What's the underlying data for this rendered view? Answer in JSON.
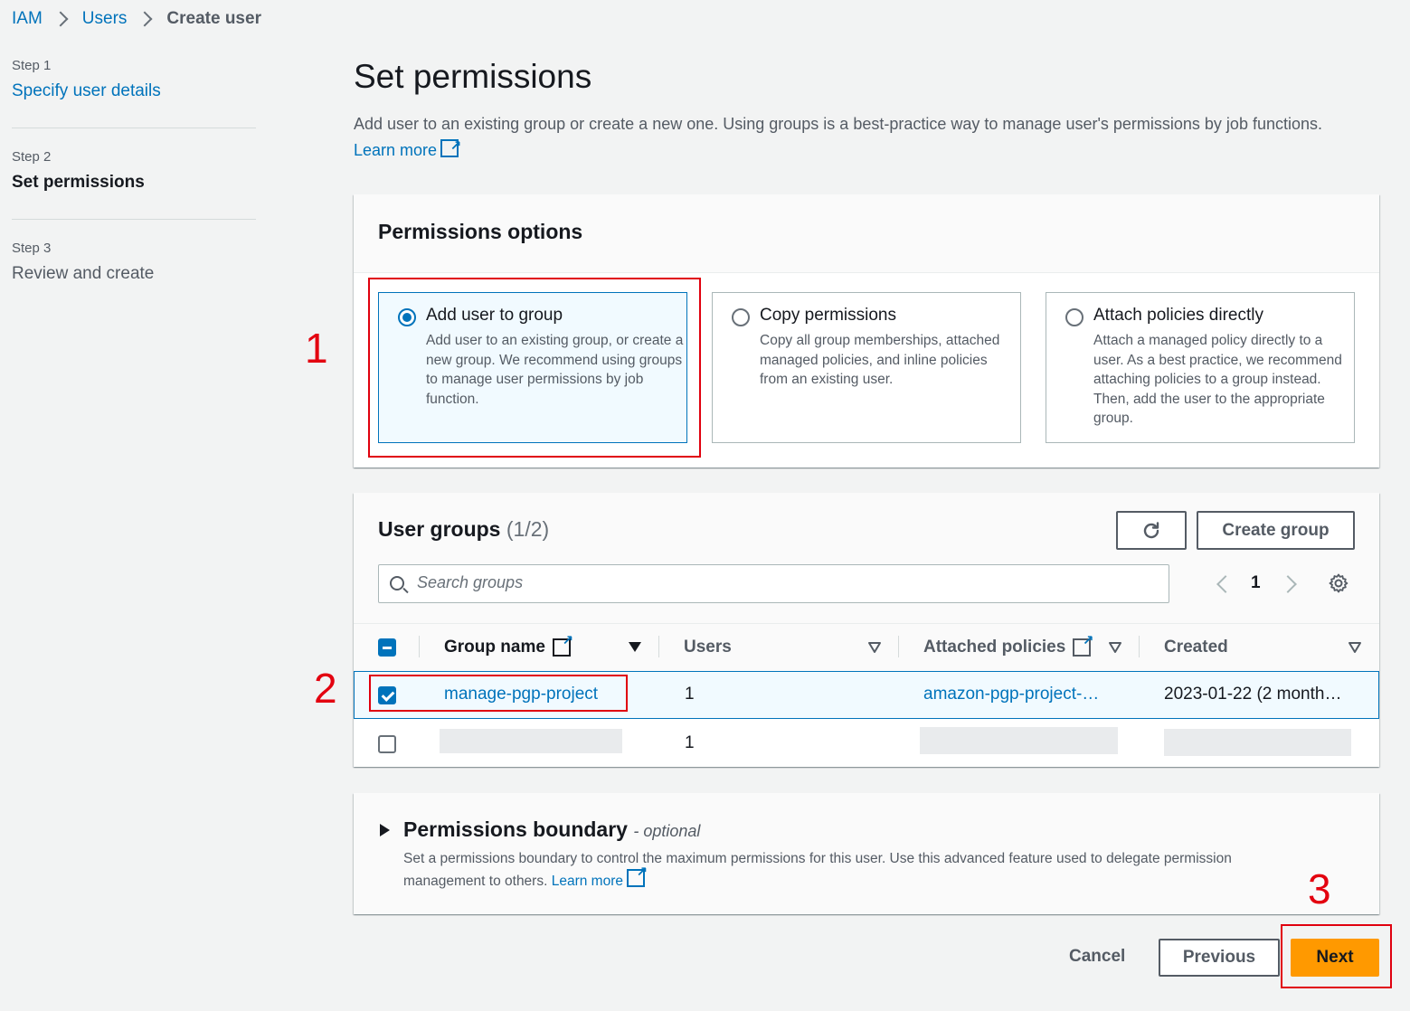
{
  "breadcrumb": {
    "iam": "IAM",
    "users": "Users",
    "current": "Create user"
  },
  "steps": [
    {
      "num": "Step 1",
      "title": "Specify user details"
    },
    {
      "num": "Step 2",
      "title": "Set permissions"
    },
    {
      "num": "Step 3",
      "title": "Review and create"
    }
  ],
  "header": {
    "title": "Set permissions",
    "description": "Add user to an existing group or create a new one. Using groups is a best-practice way to manage user's permissions by job functions.",
    "learn_more": "Learn more"
  },
  "permissions_options": {
    "heading": "Permissions options",
    "options": [
      {
        "title": "Add user to group",
        "desc": "Add user to an existing group, or create a new group. We recommend using groups to manage user permissions by job function.",
        "selected": true
      },
      {
        "title": "Copy permissions",
        "desc": "Copy all group memberships, attached managed policies, and inline policies from an existing user.",
        "selected": false
      },
      {
        "title": "Attach policies directly",
        "desc": "Attach a managed policy directly to a user. As a best practice, we recommend attaching policies to a group instead. Then, add the user to the appropriate group.",
        "selected": false
      }
    ]
  },
  "user_groups": {
    "heading": "User groups",
    "count": "(1/2)",
    "create_group": "Create group",
    "search_placeholder": "Search groups",
    "page": "1",
    "columns": {
      "group_name": "Group name",
      "users": "Users",
      "attached_policies": "Attached policies",
      "created": "Created"
    },
    "rows": [
      {
        "checked": true,
        "group_name": "manage-pgp-project",
        "users": "1",
        "policies": "amazon-pgp-project-…",
        "created": "2023-01-22 (2 month…"
      },
      {
        "checked": false,
        "group_name": "",
        "users": "1",
        "policies": "",
        "created": ""
      }
    ]
  },
  "boundary": {
    "title": "Permissions boundary",
    "optional": "- optional",
    "desc": "Set a permissions boundary to control the maximum permissions for this user. Use this advanced feature used to delegate permission management to others.",
    "learn_more": "Learn more"
  },
  "footer": {
    "cancel": "Cancel",
    "previous": "Previous",
    "next": "Next"
  },
  "annotations": {
    "one": "1",
    "two": "2",
    "three": "3"
  },
  "colors": {
    "link": "#0073bb",
    "primary": "#ff9900",
    "annotation": "#e3000f"
  }
}
